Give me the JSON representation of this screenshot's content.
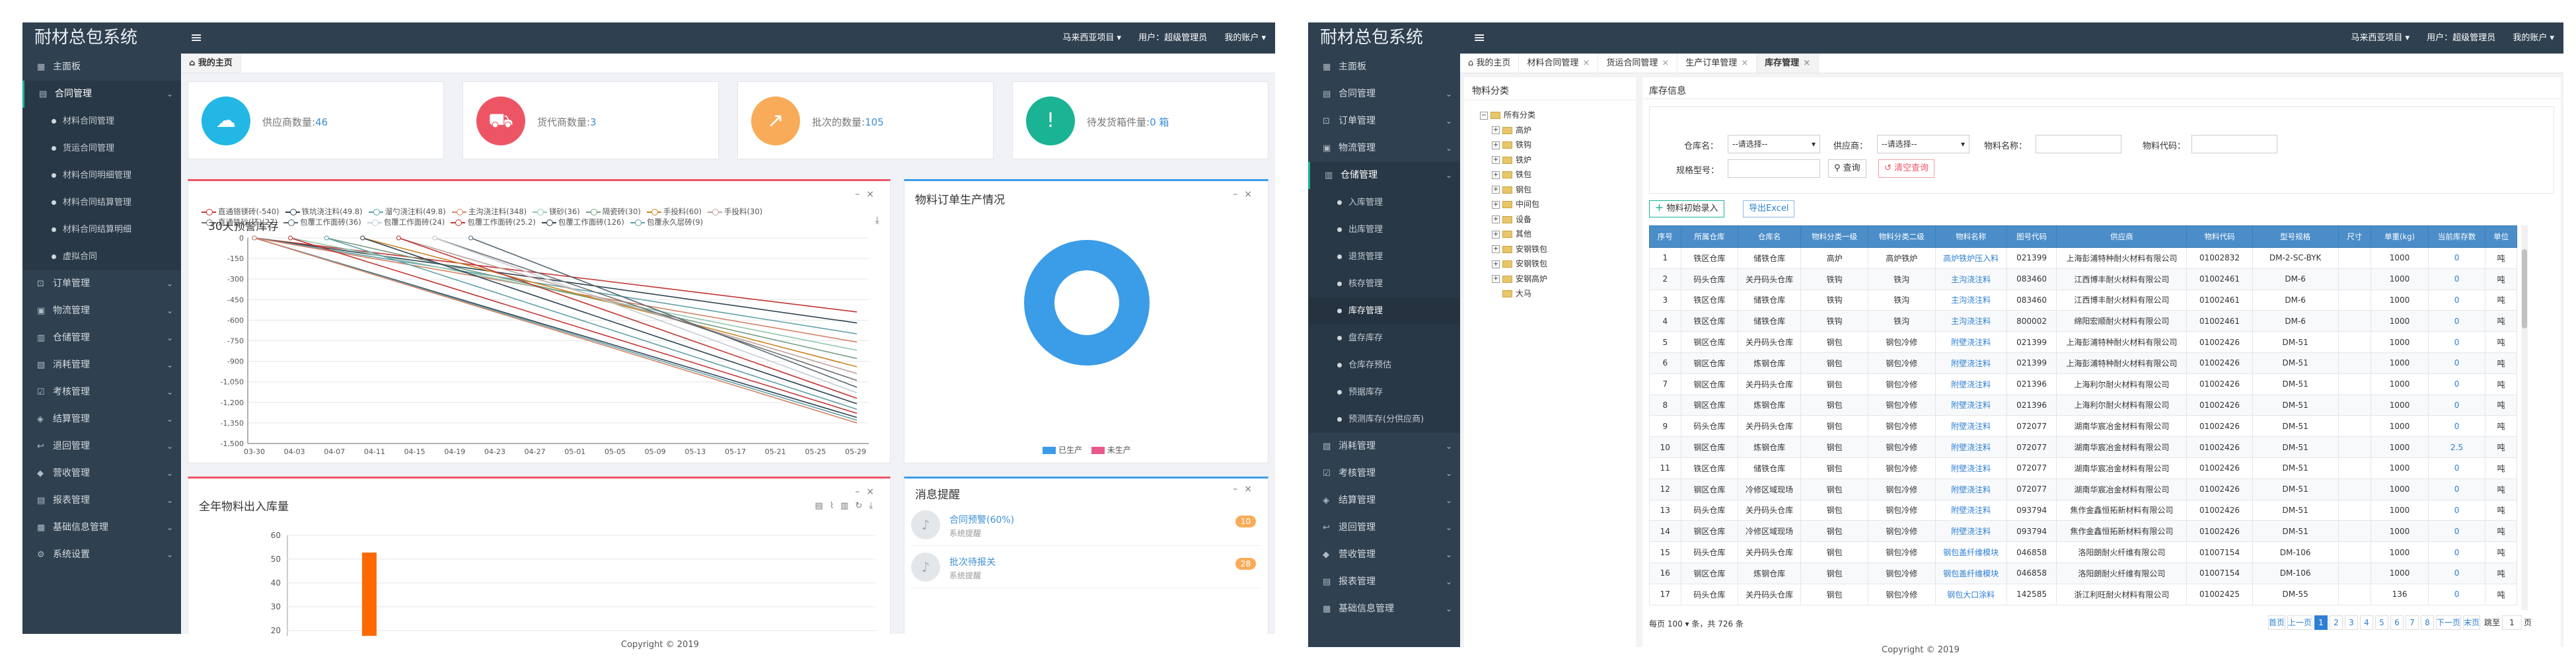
{
  "brand": "耐材总包系统",
  "topnav": {
    "project": "马来西亚项目 ▾",
    "user": "用户：超级管理员",
    "account": "我的账户 ▾"
  },
  "left": {
    "sidebar": [
      {
        "label": "主面板",
        "icon": "dashboard-icon",
        "glyph": "▦",
        "type": "item"
      },
      {
        "label": "合同管理",
        "icon": "contract-icon",
        "glyph": "▤",
        "type": "open"
      },
      {
        "label": "材料合同管理",
        "type": "sub"
      },
      {
        "label": "货运合同管理",
        "type": "sub"
      },
      {
        "label": "材料合同明细管理",
        "type": "sub"
      },
      {
        "label": "材料合同结算管理",
        "type": "sub"
      },
      {
        "label": "材料合同结算明细",
        "type": "sub"
      },
      {
        "label": "虚拟合同",
        "type": "sub"
      },
      {
        "label": "订单管理",
        "icon": "cart-icon",
        "glyph": "⊡",
        "type": "item"
      },
      {
        "label": "物流管理",
        "icon": "truck-icon",
        "glyph": "▣",
        "type": "item"
      },
      {
        "label": "仓储管理",
        "icon": "warehouse-icon",
        "glyph": "▥",
        "type": "item"
      },
      {
        "label": "消耗管理",
        "icon": "consume-icon",
        "glyph": "▧",
        "type": "item"
      },
      {
        "label": "考核管理",
        "icon": "check-icon",
        "glyph": "☑",
        "type": "item"
      },
      {
        "label": "结算管理",
        "icon": "settle-icon",
        "glyph": "◈",
        "type": "item"
      },
      {
        "label": "退回管理",
        "icon": "return-icon",
        "glyph": "↩",
        "type": "item"
      },
      {
        "label": "营收管理",
        "icon": "revenue-icon",
        "glyph": "◆",
        "type": "item"
      },
      {
        "label": "报表管理",
        "icon": "report-icon",
        "glyph": "▤",
        "type": "item"
      },
      {
        "label": "基础信息管理",
        "icon": "info-icon",
        "glyph": "▦",
        "type": "item"
      },
      {
        "label": "系统设置",
        "icon": "gear-icon",
        "glyph": "⚙",
        "type": "item"
      }
    ],
    "tab": "我的主页",
    "stats": [
      {
        "label": "供应商数量:",
        "value": "46",
        "color": "#23b7e5",
        "icon": "supplier-icon",
        "glyph": "☁"
      },
      {
        "label": "货代商数量:",
        "value": "3",
        "color": "#ed5565",
        "icon": "forwarder-icon",
        "glyph": "⛟"
      },
      {
        "label": "批次的数量:",
        "value": "105",
        "color": "#f8ac59",
        "icon": "batch-icon",
        "glyph": "↗"
      },
      {
        "label": "待发货箱件量:",
        "value": "0 箱",
        "color": "#1ab394",
        "icon": "warning-icon",
        "glyph": "!"
      }
    ],
    "inventory_chart": {
      "legend": [
        {
          "name": "直通铬镁砖(-540)",
          "color": "#c23531"
        },
        {
          "name": "铁坑浇注料(49.8)",
          "color": "#2f4554"
        },
        {
          "name": "溜勺浇注料(49.8)",
          "color": "#61a0a8"
        },
        {
          "name": "主沟浇注料(348)",
          "color": "#d48265"
        },
        {
          "name": "镁砂(36)",
          "color": "#91c7ae"
        },
        {
          "name": "隔瓷砖(30)",
          "color": "#749f83"
        },
        {
          "name": "手投料(60)",
          "color": "#ca8622"
        },
        {
          "name": "手投料(30)",
          "color": "#bda29a"
        },
        {
          "name": "直通铁砂(环)(27)",
          "color": "#6e7074"
        },
        {
          "name": "包覆工作面砖(36)",
          "color": "#546570"
        },
        {
          "name": "包覆工作面砖(24)",
          "color": "#c4ccd3"
        },
        {
          "name": "包覆工作面砖(25.2)",
          "color": "#c23531"
        },
        {
          "name": "包覆工作面砖(126)",
          "color": "#2f4554"
        },
        {
          "name": "包覆永久层砖(9)",
          "color": "#61a0a8"
        }
      ]
    },
    "order_chart": {
      "title": "物料订单生产情况",
      "legend": [
        {
          "name": "已生产",
          "color": "#3b9ce8"
        },
        {
          "name": "未生产",
          "color": "#e8598a"
        }
      ]
    },
    "annual_chart": {
      "title": "全年物料出入库量"
    },
    "messages": {
      "title": "消息提醒",
      "items": [
        {
          "title": "合同预警(60%)",
          "sub": "系统提醒",
          "badge": "10"
        },
        {
          "title": "批次待报关",
          "sub": "系统提醒",
          "badge": "28"
        }
      ]
    },
    "footer": "Copyright © 2019"
  },
  "right": {
    "sidebar": [
      {
        "label": "主面板",
        "icon": "dashboard-icon",
        "glyph": "▦",
        "type": "item"
      },
      {
        "label": "合同管理",
        "icon": "contract-icon",
        "glyph": "▤",
        "type": "item"
      },
      {
        "label": "订单管理",
        "icon": "cart-icon",
        "glyph": "⊡",
        "type": "item"
      },
      {
        "label": "物流管理",
        "icon": "truck-icon",
        "glyph": "▣",
        "type": "item"
      },
      {
        "label": "仓储管理",
        "icon": "warehouse-icon",
        "glyph": "▥",
        "type": "open"
      },
      {
        "label": "入库管理",
        "type": "sub"
      },
      {
        "label": "出库管理",
        "type": "sub"
      },
      {
        "label": "退货管理",
        "type": "sub"
      },
      {
        "label": "核存管理",
        "type": "sub"
      },
      {
        "label": "库存管理",
        "type": "sub",
        "cur": true
      },
      {
        "label": "盘存库存",
        "type": "sub"
      },
      {
        "label": "仓库存预估",
        "type": "sub"
      },
      {
        "label": "预据库存",
        "type": "sub"
      },
      {
        "label": "预测库存(分供应商)",
        "type": "sub"
      },
      {
        "label": "消耗管理",
        "icon": "consume-icon",
        "glyph": "▧",
        "type": "item"
      },
      {
        "label": "考核管理",
        "icon": "check-icon",
        "glyph": "☑",
        "type": "item"
      },
      {
        "label": "结算管理",
        "icon": "settle-icon",
        "glyph": "◈",
        "type": "item"
      },
      {
        "label": "退回管理",
        "icon": "return-icon",
        "glyph": "↩",
        "type": "item"
      },
      {
        "label": "营收管理",
        "icon": "revenue-icon",
        "glyph": "◆",
        "type": "item"
      },
      {
        "label": "报表管理",
        "icon": "report-icon",
        "glyph": "▤",
        "type": "item"
      },
      {
        "label": "基础信息管理",
        "icon": "info-icon",
        "glyph": "▦",
        "type": "item"
      }
    ],
    "tabs": [
      "我的主页",
      "材料合同管理",
      "货运合同管理",
      "生产订单管理",
      "库存管理"
    ],
    "tree": {
      "title": "物料分类",
      "items": [
        {
          "label": "所有分类",
          "level": 0
        },
        {
          "label": "高炉",
          "level": 1
        },
        {
          "label": "铁钩",
          "level": 1
        },
        {
          "label": "铁炉",
          "level": 1
        },
        {
          "label": "铁包",
          "level": 1
        },
        {
          "label": "钢包",
          "level": 1
        },
        {
          "label": "中间包",
          "level": 1
        },
        {
          "label": "设备",
          "level": 1
        },
        {
          "label": "其他",
          "level": 1
        },
        {
          "label": "安钢铁包",
          "level": 1
        },
        {
          "label": "安钢铁包",
          "level": 1
        },
        {
          "label": "安钢高炉",
          "level": 1
        },
        {
          "label": "大马",
          "level": 1
        }
      ]
    },
    "inventory": {
      "title": "库存信息",
      "filters": {
        "warehouse_label": "仓库名：",
        "warehouse_value": "--请选择--",
        "supplier_label": "供应商：",
        "supplier_value": "--请选择--",
        "material_name_label": "物料名称：",
        "material_code_label": "物料代码：",
        "spec_label": "规格型号：",
        "query": "查询",
        "clear": "清空查询"
      },
      "add_button": "物料初始录入",
      "export_button": "导出Excel",
      "columns": [
        "序号",
        "所属仓库",
        "仓库名",
        "物料分类一级",
        "物料分类二级",
        "物料名称",
        "图号代码",
        "供应商",
        "物料代码",
        "型号规格",
        "尺寸",
        "单重(kg)",
        "当前库存数",
        "单位"
      ],
      "rows": [
        [
          "1",
          "铁区仓库",
          "储铁仓库",
          "高炉",
          "高炉铁炉",
          "高炉铁炉压入料",
          "021399",
          "上海彭浦特种耐火材料有限公司",
          "01002832",
          "DM-2-SC-BYK",
          "",
          "1000",
          "0",
          "吨"
        ],
        [
          "2",
          "码头仓库",
          "关丹码头仓库",
          "铁钩",
          "铁沟",
          "主沟浇注料",
          "083460",
          "江西博丰耐火材料有限公司",
          "01002461",
          "DM-6",
          "",
          "1000",
          "0",
          "吨"
        ],
        [
          "3",
          "铁区仓库",
          "储铁仓库",
          "铁钩",
          "铁沟",
          "主沟浇注料",
          "083460",
          "江西博丰耐火材料有限公司",
          "01002461",
          "DM-6",
          "",
          "1000",
          "0",
          "吨"
        ],
        [
          "4",
          "铁区仓库",
          "储铁仓库",
          "铁钩",
          "铁沟",
          "主沟浇注料",
          "800002",
          "绵阳宏顺耐火材料有限公司",
          "01002461",
          "DM-6",
          "",
          "1000",
          "0",
          "吨"
        ],
        [
          "5",
          "钢区仓库",
          "关丹码头仓库",
          "钢包",
          "钢包冷修",
          "附壁浇注料",
          "021399",
          "上海彭浦特种耐火材料有限公司",
          "01002426",
          "DM-51",
          "",
          "1000",
          "0",
          "吨"
        ],
        [
          "6",
          "钢区仓库",
          "炼钢仓库",
          "钢包",
          "钢包冷修",
          "附壁浇注料",
          "021399",
          "上海彭浦特种耐火材料有限公司",
          "01002426",
          "DM-51",
          "",
          "1000",
          "0",
          "吨"
        ],
        [
          "7",
          "钢区仓库",
          "关丹码头仓库",
          "钢包",
          "钢包冷修",
          "附壁浇注料",
          "021396",
          "上海利尔耐火材料有限公司",
          "01002426",
          "DM-51",
          "",
          "1000",
          "0",
          "吨"
        ],
        [
          "8",
          "钢区仓库",
          "炼钢仓库",
          "钢包",
          "钢包冷修",
          "附壁浇注料",
          "021396",
          "上海利尔耐火材料有限公司",
          "01002426",
          "DM-51",
          "",
          "1000",
          "0",
          "吨"
        ],
        [
          "9",
          "码头仓库",
          "关丹码头仓库",
          "钢包",
          "钢包冷修",
          "附壁浇注料",
          "072077",
          "湖南华宸冶金材料有限公司",
          "01002426",
          "DM-51",
          "",
          "1000",
          "0",
          "吨"
        ],
        [
          "10",
          "钢区仓库",
          "炼钢仓库",
          "钢包",
          "钢包冷修",
          "附壁浇注料",
          "072077",
          "湖南华宸冶金材料有限公司",
          "01002426",
          "DM-51",
          "",
          "1000",
          "2.5",
          "吨"
        ],
        [
          "11",
          "铁区仓库",
          "储铁仓库",
          "钢包",
          "钢包冷修",
          "附壁浇注料",
          "072077",
          "湖南华宸冶金材料有限公司",
          "01002426",
          "DM-51",
          "",
          "1000",
          "0",
          "吨"
        ],
        [
          "12",
          "钢区仓库",
          "冷修区域现场",
          "钢包",
          "钢包冷修",
          "附壁浇注料",
          "072077",
          "湖南华宸冶金材料有限公司",
          "01002426",
          "DM-51",
          "",
          "1000",
          "0",
          "吨"
        ],
        [
          "13",
          "码头仓库",
          "关丹码头仓库",
          "钢包",
          "钢包冷修",
          "附壁浇注料",
          "093794",
          "焦作金鑫恒拓新材料有限公司",
          "01002426",
          "DM-51",
          "",
          "1000",
          "0",
          "吨"
        ],
        [
          "14",
          "钢区仓库",
          "冷修区域现场",
          "钢包",
          "钢包冷修",
          "附壁浇注料",
          "093794",
          "焦作金鑫恒拓新材料有限公司",
          "01002426",
          "DM-51",
          "",
          "1000",
          "0",
          "吨"
        ],
        [
          "15",
          "码头仓库",
          "关丹码头仓库",
          "钢包",
          "钢包冷修",
          "钢包盖纤维模块",
          "046858",
          "洛阳朗耐火纤维有限公司",
          "01007154",
          "DM-106",
          "",
          "1000",
          "0",
          "吨"
        ],
        [
          "16",
          "钢区仓库",
          "炼钢仓库",
          "钢包",
          "钢包冷修",
          "钢包盖纤维模块",
          "046858",
          "洛阳朗耐火纤维有限公司",
          "01007154",
          "DM-106",
          "",
          "1000",
          "0",
          "吨"
        ],
        [
          "17",
          "码头仓库",
          "关丹码头仓库",
          "钢包",
          "钢包冷修",
          "钢包大口涂料",
          "142585",
          "浙江利旺耐火材料有限公司",
          "01002425",
          "DM-55",
          "",
          "136",
          "0",
          "吨"
        ]
      ]
    },
    "pager": {
      "left": "每页 100 ▾ 条，共 726 条",
      "first": "首页",
      "prev": "上一页",
      "pages": [
        "1",
        "2",
        "3",
        "4",
        "5",
        "6",
        "7",
        "8"
      ],
      "next": "下一页",
      "last": "末页",
      "jump": "跳至",
      "jump_value": "1",
      "jump_unit": "页"
    },
    "footer": "Copyright © 2019"
  }
}
